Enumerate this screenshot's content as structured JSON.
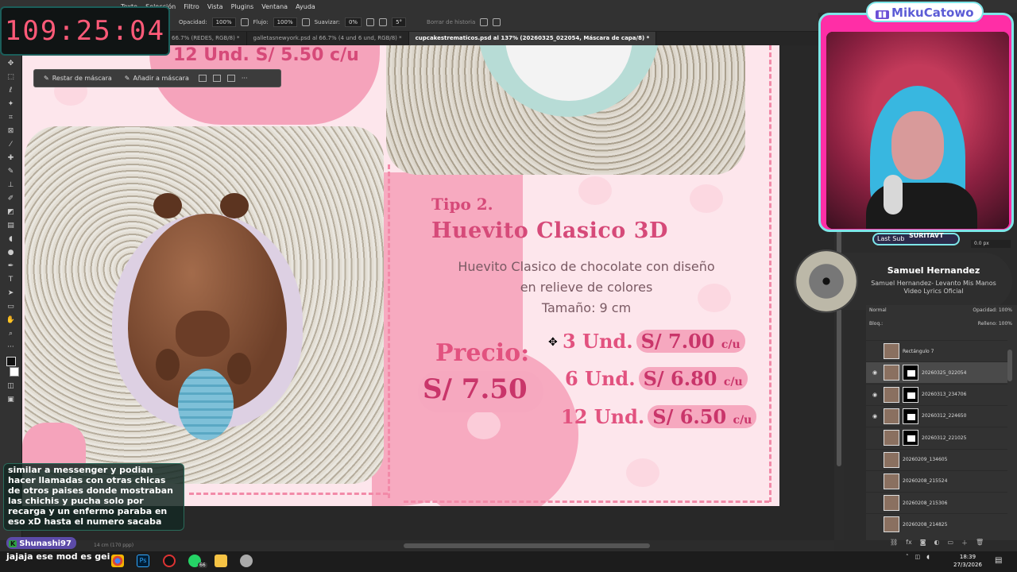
{
  "menubar": {
    "items": [
      "Texto",
      "Selección",
      "Filtro",
      "Vista",
      "Plugins",
      "Ventana",
      "Ayuda"
    ]
  },
  "options": {
    "opacity_label": "Opacidad:",
    "opacity_value": "100%",
    "flow_label": "Flujo:",
    "flow_value": "100%",
    "smooth_label": "Suavizar:",
    "smooth_value": "0%",
    "angle_value": "5°",
    "erase_history": "Borrar de historia"
  },
  "tabs": [
    {
      "label": "66.7% (REDES, RGB/8) *"
    },
    {
      "label": "galletasnewyork.psd al 66.7% (4 und    6 und, RGB/8) *"
    },
    {
      "label": "cupcakestrematicos.psd al 137% (20260325_022054, Máscara de capa/8) *"
    }
  ],
  "mask_toolbar": {
    "restore": "Restar de máscara",
    "add": "Añadir a máscara",
    "more": "···"
  },
  "document": {
    "top_price": "12 Und. S/ 5.50 c/u",
    "tipo": "Tipo 2.",
    "title": "Huevito Clasico 3D",
    "desc_lines": [
      "Huevito Clasico de chocolate con diseño",
      "en relieve de colores",
      "Tamaño: 9 cm"
    ],
    "precio_label": "Precio:",
    "price_main": "S/ 7.50",
    "rows": [
      {
        "qty": "3 Und.",
        "price": "S/ 7.00",
        "unit": "c/u"
      },
      {
        "qty": "6 Und.",
        "price": "S/ 6.80",
        "unit": "c/u"
      },
      {
        "qty": "12 Und.",
        "price": "S/ 6.50",
        "unit": "c/u"
      }
    ]
  },
  "statusbar": {
    "text": "14 cm (170 ppp)"
  },
  "timer": {
    "value": "109:25:04"
  },
  "stream": {
    "channel": "MikuCatowo",
    "last_sub_label": "Last Sub",
    "last_sub_name": "SURITAVT",
    "size_value": "0.0 px"
  },
  "music": {
    "title": "Samuel Hernandez",
    "subtitle": "Samuel Hernandez- Levanto Mis Manos Video Lyrics Oficial"
  },
  "layers": {
    "blend": "Normal",
    "opacity_label": "Opacidad:",
    "opacity_value": "100%",
    "lock_label": "Bloq.:",
    "fill_label": "Relleno:",
    "fill_value": "100%",
    "items": [
      {
        "name": "Rectángulo 7",
        "visible": false,
        "mask": false,
        "active": false
      },
      {
        "name": "20260325_022054",
        "visible": true,
        "mask": true,
        "active": true
      },
      {
        "name": "20260313_234706",
        "visible": true,
        "mask": true,
        "active": false
      },
      {
        "name": "20260312_224650",
        "visible": true,
        "mask": true,
        "active": false
      },
      {
        "name": "20260312_221025",
        "visible": false,
        "mask": true,
        "active": false
      },
      {
        "name": "20260209_134605",
        "visible": false,
        "mask": false,
        "active": false
      },
      {
        "name": "20260208_215524",
        "visible": false,
        "mask": false,
        "active": false
      },
      {
        "name": "20260208_215306",
        "visible": false,
        "mask": false,
        "active": false
      },
      {
        "name": "20260208_214825",
        "visible": false,
        "mask": false,
        "active": false
      }
    ]
  },
  "chat": {
    "message1": "similar a messenger y podian hacer llamadas con otras chicas de otros paises donde mostraban las chichis y pucha solo por recarga y un enfermo paraba en eso xD hasta el numero sacaba",
    "user2": "Shunashi97",
    "message2": "jajaja ese mod es gei"
  },
  "taskbar": {
    "time": "18:39",
    "date": "27/3/2026",
    "badge": "66"
  },
  "colors": {
    "accent_pink": "#e2527f",
    "frame_cyan": "#7ee6e8",
    "frame_magenta": "#ff2ea6"
  }
}
